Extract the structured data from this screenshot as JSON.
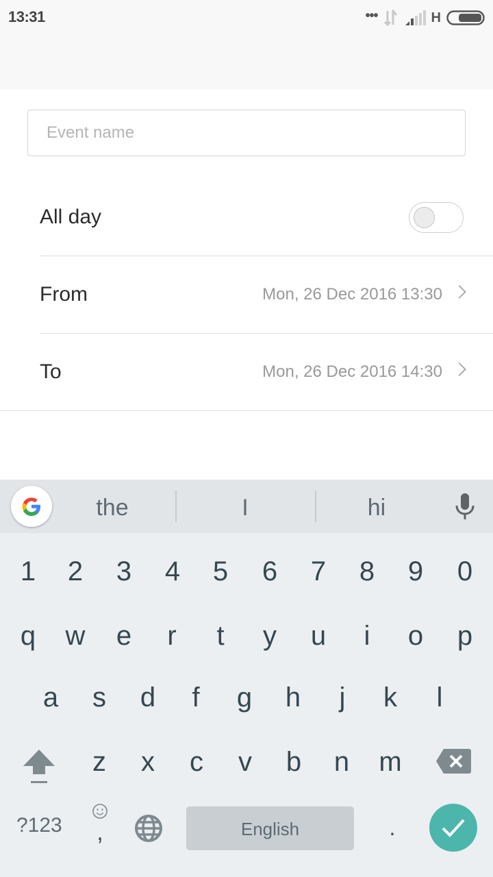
{
  "status_bar": {
    "time": "13:31",
    "more_dots": "•••",
    "network_type": "H"
  },
  "form": {
    "event_name": {
      "value": "",
      "placeholder": "Event name"
    },
    "all_day": {
      "label": "All day",
      "enabled": false
    },
    "from": {
      "label": "From",
      "value": "Mon, 26 Dec 2016 13:30"
    },
    "to": {
      "label": "To",
      "value": "Mon, 26 Dec 2016 14:30"
    }
  },
  "keyboard": {
    "suggestions": [
      "the",
      "I",
      "hi"
    ],
    "number_row": [
      "1",
      "2",
      "3",
      "4",
      "5",
      "6",
      "7",
      "8",
      "9",
      "0"
    ],
    "row1": [
      "q",
      "w",
      "e",
      "r",
      "t",
      "y",
      "u",
      "i",
      "o",
      "p"
    ],
    "row2": [
      "a",
      "s",
      "d",
      "f",
      "g",
      "h",
      "j",
      "k",
      "l"
    ],
    "row3": [
      "z",
      "x",
      "c",
      "v",
      "b",
      "n",
      "m"
    ],
    "symbols_label": "?123",
    "comma": ",",
    "period": ".",
    "space_label": "English",
    "colors": {
      "enter": "#4db6ac",
      "background": "#ebeff2",
      "suggestion_bar": "#e1e5e8"
    }
  }
}
